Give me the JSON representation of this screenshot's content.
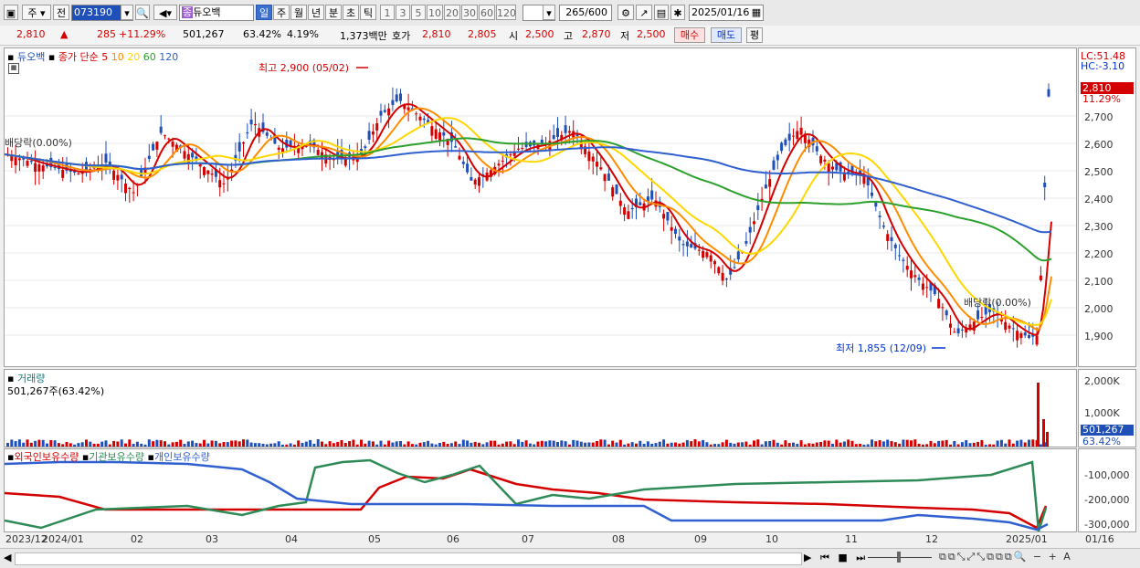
{
  "toolbar": {
    "mode1": "주",
    "mode2": "전",
    "code": "073190",
    "name_badge": "종",
    "name": "듀오백",
    "periods": [
      "일",
      "주",
      "월",
      "년",
      "분",
      "초",
      "틱"
    ],
    "selected_period": "일",
    "nums": [
      "1",
      "3",
      "5",
      "10",
      "20",
      "30",
      "60",
      "120"
    ],
    "count": "265",
    "count_total": "/600",
    "date": "2025/01/16"
  },
  "quote": {
    "price": "2,810",
    "arrow": "▲",
    "change": "285",
    "change_pct": "+11.29%",
    "volume": "501,267",
    "vol_ratio": "63.42%",
    "turnover": "4.19%",
    "amount": "1,373백만",
    "hoga_label": "호가",
    "ask": "2,810",
    "bid": "2,805",
    "open_label": "시",
    "open": "2,500",
    "high_label": "고",
    "high": "2,870",
    "low_label": "저",
    "low": "2,500",
    "buy_button": "매수",
    "sell_button": "매도",
    "eval_button": "평"
  },
  "price_panel": {
    "legend_name": "듀오백",
    "legend_ma": "종가 단순",
    "ma_periods": [
      "5",
      "10",
      "20",
      "60",
      "120"
    ],
    "ma_colors": [
      "#d40000",
      "#ff8c00",
      "#ffd700",
      "#2ca02c",
      "#3060d0"
    ],
    "annotation_high": "최고 2,900 (05/02)",
    "annotation_low": "최저 1,855 (12/09)",
    "dividend_left": "배당락(0.00%)",
    "dividend_right": "배당락(0.00%)",
    "lc": "LC:51.48",
    "hc": "HC:-3.10",
    "current_price_tag": "2,810",
    "current_pct_tag": "11.29%",
    "y_ticks": [
      "2,700",
      "2,600",
      "2,500",
      "2,400",
      "2,300",
      "2,200",
      "2,100",
      "2,000",
      "1,900"
    ]
  },
  "volume_panel": {
    "title": "거래량",
    "value": "501,267주(63.42%)",
    "y_ticks": [
      "2,000K",
      "1,000K"
    ],
    "current_tag": "501,267",
    "current_pct": "63.42%"
  },
  "holding_panel": {
    "series": [
      {
        "name": "외국인보유수량",
        "color": "#d40000"
      },
      {
        "name": "기관보유수량",
        "color": "#2e8b57"
      },
      {
        "name": "개인보유수량",
        "color": "#3060d0"
      }
    ],
    "y_ticks": [
      "-100,000",
      "-200,000",
      "-300,000"
    ]
  },
  "x_axis": [
    "2023/12",
    "2024/01",
    "02",
    "03",
    "04",
    "05",
    "06",
    "07",
    "08",
    "09",
    "10",
    "11",
    "12",
    "2025/01",
    "01/16"
  ]
}
